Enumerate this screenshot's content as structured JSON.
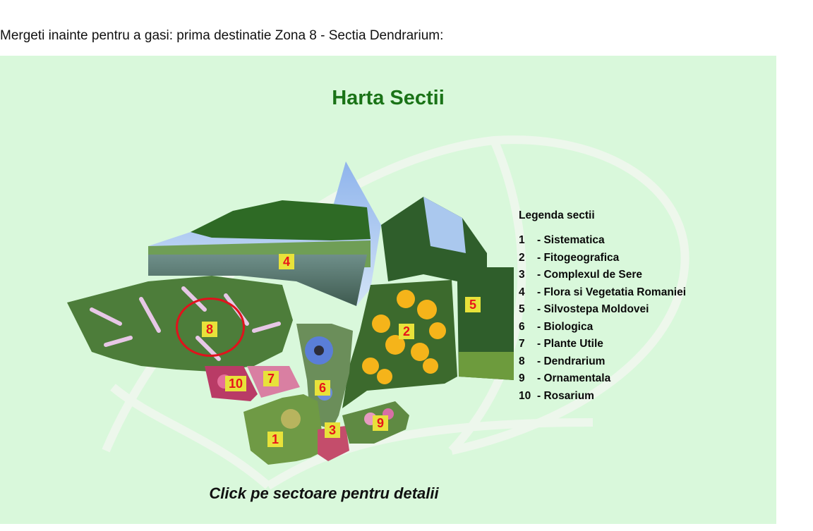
{
  "intro_text": "Mergeti inainte pentru a gasi: prima destinatie Zona 8 - Sectia Dendrarium:",
  "map": {
    "title": "Harta Sectii",
    "click_hint": "Click pe sectoare pentru detalii",
    "highlighted_zone": "8",
    "colors": {
      "panel_bg": "#d9f8db",
      "title": "#1a7317",
      "marker_bg": "#e8e23a",
      "marker_text": "#e8141a",
      "highlight_ring": "#e0121c"
    }
  },
  "legend": {
    "title": "Legenda sectii",
    "items": [
      {
        "num": "1",
        "name": "Sistematica"
      },
      {
        "num": "2",
        "name": "Fitogeografica"
      },
      {
        "num": "3",
        "name": "Complexul de Sere"
      },
      {
        "num": "4",
        "name": "Flora si Vegetatia Romaniei"
      },
      {
        "num": "5",
        "name": "Silvostepa Moldovei"
      },
      {
        "num": "6",
        "name": "Biologica"
      },
      {
        "num": "7",
        "name": "Plante Utile"
      },
      {
        "num": "8",
        "name": "Dendrarium"
      },
      {
        "num": "9",
        "name": "Ornamentala"
      },
      {
        "num": "10",
        "name": "Rosarium"
      }
    ]
  }
}
